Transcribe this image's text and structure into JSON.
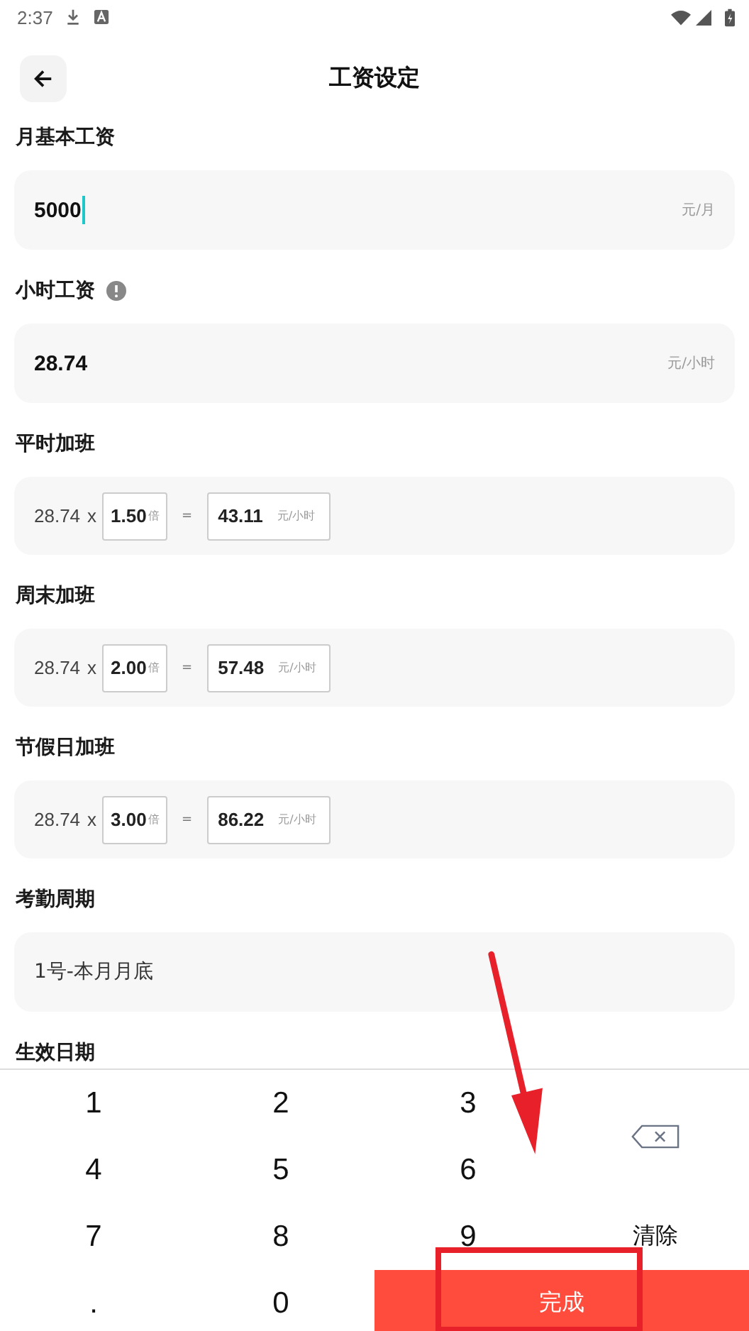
{
  "status_bar": {
    "time": "2:37"
  },
  "header": {
    "title": "工资设定"
  },
  "monthly_salary": {
    "label": "月基本工资",
    "value": "5000",
    "unit": "元/月",
    "focused": true
  },
  "hourly_wage": {
    "label": "小时工资",
    "value": "28.74",
    "unit": "元/小时",
    "focused": false
  },
  "overtime": [
    {
      "label": "平时加班",
      "base": "28.74",
      "times": "x",
      "multiplier": "1.50",
      "multiplier_unit": "倍",
      "equals": "=",
      "result": "43.11",
      "result_unit": "元/小时"
    },
    {
      "label": "周末加班",
      "base": "28.74",
      "times": "x",
      "multiplier": "2.00",
      "multiplier_unit": "倍",
      "equals": "=",
      "result": "57.48",
      "result_unit": "元/小时"
    },
    {
      "label": "节假日加班",
      "base": "28.74",
      "times": "x",
      "multiplier": "3.00",
      "multiplier_unit": "倍",
      "equals": "=",
      "result": "86.22",
      "result_unit": "元/小时"
    }
  ],
  "attendance_period": {
    "label": "考勤周期",
    "value": "1号-本月月底"
  },
  "effective_date": {
    "label": "生效日期"
  },
  "keypad": {
    "keys": [
      {
        "kind": "key",
        "label": "1"
      },
      {
        "kind": "key",
        "label": "2"
      },
      {
        "kind": "key",
        "label": "3"
      },
      {
        "kind": "backspace"
      },
      {
        "kind": "key",
        "label": "4"
      },
      {
        "kind": "key",
        "label": "5"
      },
      {
        "kind": "key",
        "label": "6"
      },
      {
        "kind": "key",
        "label": "7"
      },
      {
        "kind": "key",
        "label": "8"
      },
      {
        "kind": "key",
        "label": "9"
      },
      {
        "kind": "clear",
        "label": "清除"
      },
      {
        "kind": "key",
        "label": "."
      },
      {
        "kind": "key",
        "label": "0"
      },
      {
        "kind": "done",
        "label": "完成"
      }
    ]
  }
}
